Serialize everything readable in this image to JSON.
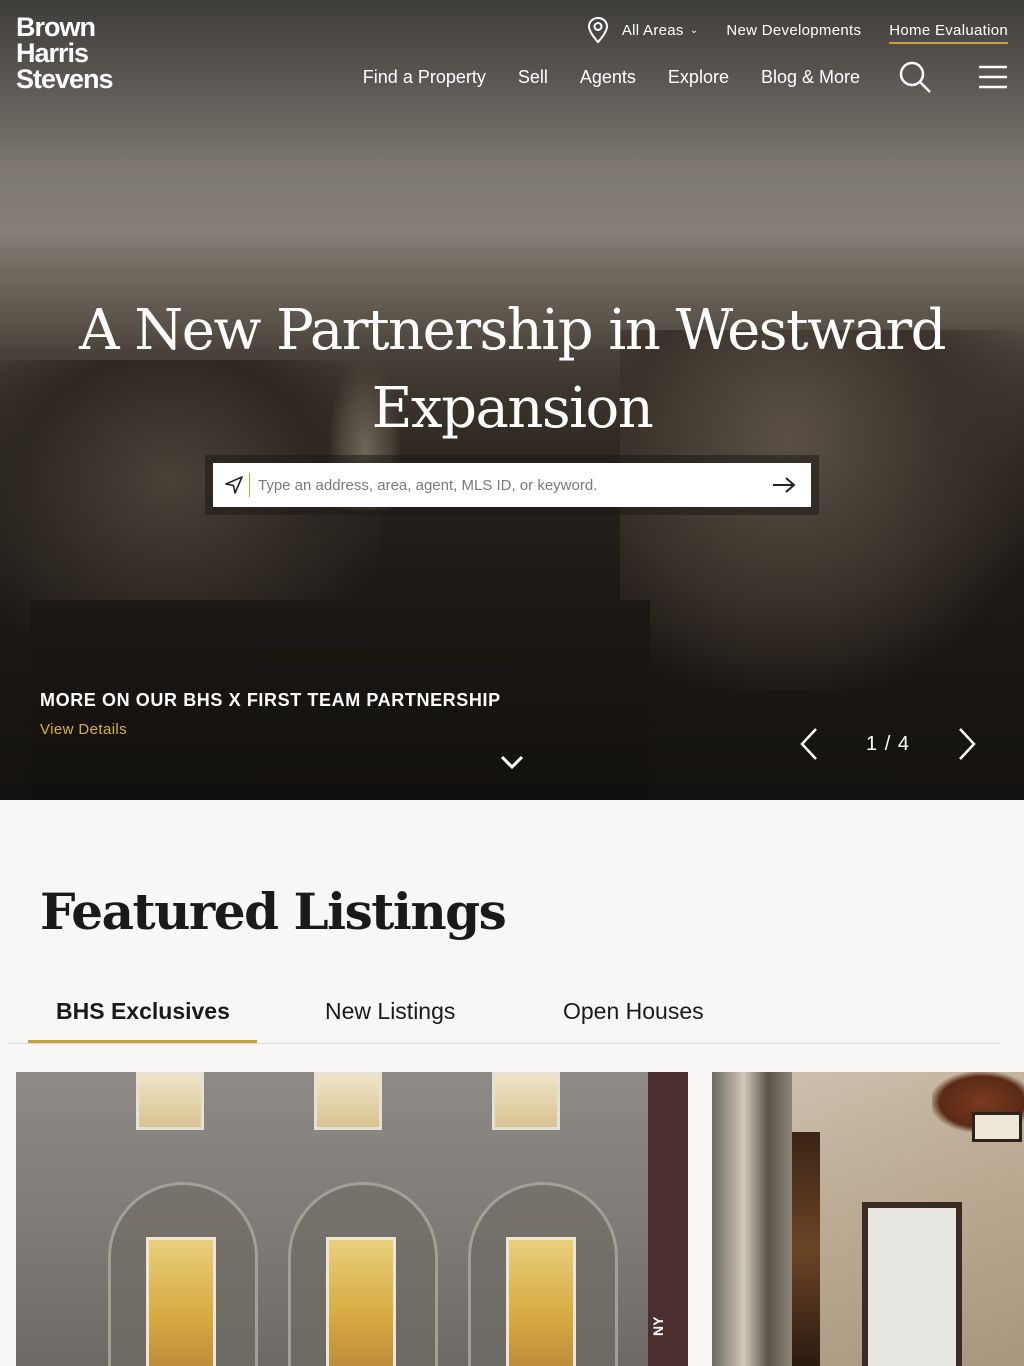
{
  "brand": {
    "line1": "Brown",
    "line2": "Harris",
    "line3": "Stevens"
  },
  "top_nav": {
    "areas_label": "All Areas",
    "new_developments": "New Developments",
    "home_evaluation": "Home Evaluation"
  },
  "main_nav": {
    "items": [
      "Find a Property",
      "Sell",
      "Agents",
      "Explore",
      "Blog & More"
    ]
  },
  "hero": {
    "headline_line1": "A New Partnership in Westward",
    "headline_line2": "Expansion",
    "search_placeholder": "Type an address, area, agent, MLS ID, or keyword.",
    "promo_title": "MORE ON OUR BHS X FIRST TEAM PARTNERSHIP",
    "promo_link": "View Details",
    "slide_counter": "1 / 4"
  },
  "featured": {
    "title": "Featured Listings",
    "tabs": [
      "BHS Exclusives",
      "New Listings",
      "Open Houses"
    ],
    "active_tab": "BHS Exclusives",
    "card1_vertical_text": "NY"
  },
  "colors": {
    "accent": "#c9a23a",
    "link_gold": "#d9b040",
    "background": "#f8f7f5"
  }
}
